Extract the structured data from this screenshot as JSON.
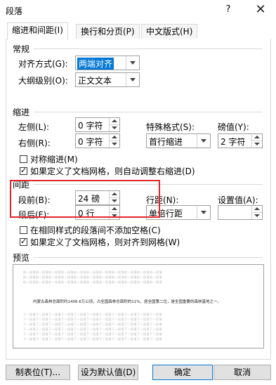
{
  "window": {
    "title": "段落",
    "help": "?",
    "close": "✕"
  },
  "tabs": [
    {
      "label": "缩进和间距(I)"
    },
    {
      "label": "换行和分页(P)"
    },
    {
      "label": "中文版式(H)"
    }
  ],
  "general": {
    "heading": "常规",
    "alignment_label": "对齐方式(G):",
    "alignment_value": "两端对齐",
    "outline_label": "大纲级别(O):",
    "outline_value": "正文文本"
  },
  "indent": {
    "heading": "缩进",
    "left_label": "左侧(L):",
    "left_value": "0 字符",
    "right_label": "右侧(R):",
    "right_value": "0 字符",
    "special_label": "特殊格式(S):",
    "special_value": "首行缩进",
    "by_label": "磅值(Y):",
    "by_value": "2 字符",
    "mirror_label": "对称缩进(M)",
    "mirror_checked": false,
    "auto_right_label": "如果定义了文档网格，则自动调整右缩进(D)",
    "auto_right_checked": true
  },
  "spacing": {
    "heading": "间距",
    "before_label": "段前(B):",
    "before_value": "24 磅",
    "after_label": "段后(F):",
    "after_value": "0 行",
    "line_label": "行距(N):",
    "line_value": "单倍行距",
    "at_label": "设置值(A):",
    "at_value": "",
    "no_space_label": "在相同样式的段落间不添加空格(C)",
    "no_space_checked": false,
    "snap_grid_label": "如果定义了文档网格，则对齐到网格(W)",
    "snap_grid_checked": true
  },
  "preview": {
    "heading": "预览",
    "prev_text": "前一段落前一段落前一段落前一段落前一段落前一段落前一段落前一段落前一段落前一段落前一段落",
    "current_text": "内蒙古森林总面积约1406.6万公顷，占全国森林总面积的11%，居全国第二位，是全国重要的森林基地之一。",
    "next_text": "下一段落下一段落下一段落下一段落下一段落下一段落下一段落下一段落下一段落下一段落下一段落"
  },
  "buttons": {
    "tabs": "制表位(T)...",
    "set_default": "设为默认值(D)",
    "ok": "确定",
    "cancel": "取消"
  },
  "colors": {
    "accent": "#0078d7",
    "highlight_box": "#e3252b",
    "selection": "#0078d7"
  }
}
